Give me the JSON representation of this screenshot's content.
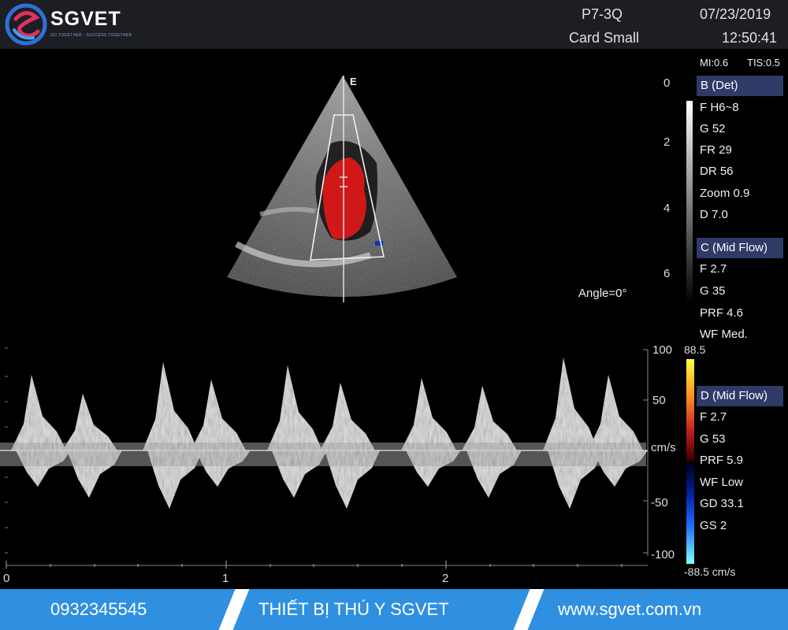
{
  "brand": {
    "name": "SGVET",
    "tagline": "GO TOGETHER - SUCCESS TOGETHER"
  },
  "header": {
    "probe": "P7-3Q",
    "preset": "Card Small",
    "date": "07/23/2019",
    "time": "12:50:41"
  },
  "indices": {
    "mi": "MI:0.6",
    "tis": "TIS:0.5"
  },
  "bmode": {
    "title": "B (Det)",
    "params": [
      "F H6~8",
      "G 52",
      "FR 29",
      "DR 56",
      "Zoom 0.9",
      "D 7.0"
    ]
  },
  "cflow": {
    "title": "C (Mid Flow)",
    "params": [
      "F 2.7",
      "G 35",
      "PRF 4.6",
      "WF Med."
    ]
  },
  "doppler": {
    "title": "D (Mid Flow)",
    "params": [
      "F 2.7",
      "G 53",
      "PRF 5.9",
      "WF Low",
      "GD 33.1",
      "GS 2"
    ]
  },
  "orientation_marker": "E",
  "angle": "Angle=0°",
  "depth_scale": [
    "0",
    "2",
    "4",
    "6"
  ],
  "velocity_scale": {
    "labels": [
      "100",
      "50",
      "cm/s",
      "-50",
      "-100"
    ],
    "color_max": "88.5",
    "color_min": "-88.5 cm/s"
  },
  "time_scale": [
    "0",
    "1",
    "2"
  ],
  "footer": {
    "phone": "0932345545",
    "title": "THIẾT BỊ THÚ Y SGVET",
    "website": "www.sgvet.com.vn"
  },
  "colors": {
    "footer_bg": "#2f8fe0",
    "header_bg": "#1c1e24",
    "param_header_bg": "#2f3a66",
    "flow_red": "#d01818",
    "flow_blue": "#1030c0"
  }
}
